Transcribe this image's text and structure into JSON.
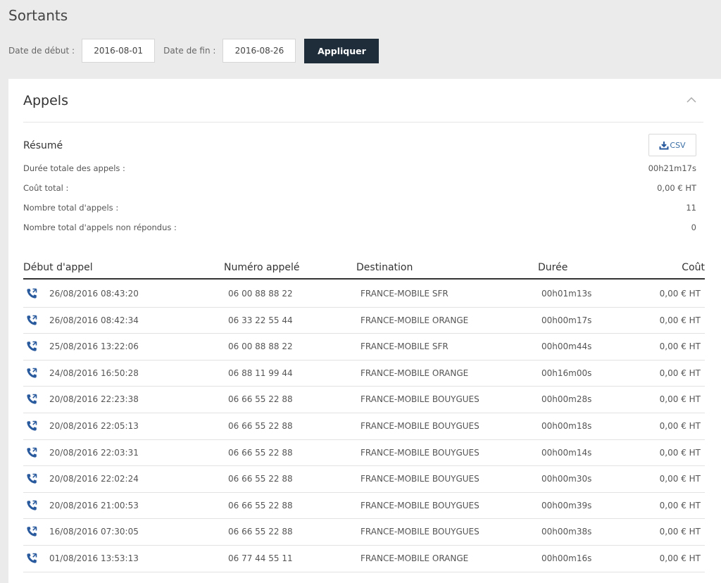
{
  "page": {
    "title": "Sortants"
  },
  "filters": {
    "start_label": "Date de début :",
    "start_value": "2016-08-01",
    "end_label": "Date de fin :",
    "end_value": "2016-08-26",
    "apply_label": "Appliquer"
  },
  "panel": {
    "title": "Appels",
    "collapse_icon": "chevron-up-icon",
    "summary": {
      "title": "Résumé",
      "csv_label": "CSV",
      "rows": [
        {
          "label": "Durée totale des appels :",
          "value": "00h21m17s"
        },
        {
          "label": "Coût total :",
          "value": "0,00 € HT"
        },
        {
          "label": "Nombre total d'appels :",
          "value": "11"
        },
        {
          "label": "Nombre total d'appels non répondus :",
          "value": "0"
        }
      ]
    },
    "table": {
      "headers": {
        "start": "Début d'appel",
        "number": "Numéro appelé",
        "destination": "Destination",
        "duration": "Durée",
        "cost": "Coût"
      },
      "row_icon": "outgoing-call-icon",
      "rows": [
        {
          "start": "26/08/2016 08:43:20",
          "number": "06 00 88 88 22",
          "destination": "FRANCE-MOBILE SFR",
          "duration": "00h01m13s",
          "cost": "0,00 € HT"
        },
        {
          "start": "26/08/2016 08:42:34",
          "number": "06 33 22 55 44",
          "destination": "FRANCE-MOBILE ORANGE",
          "duration": "00h00m17s",
          "cost": "0,00 € HT"
        },
        {
          "start": "25/08/2016 13:22:06",
          "number": "06 00 88 88 22",
          "destination": "FRANCE-MOBILE SFR",
          "duration": "00h00m44s",
          "cost": "0,00 € HT"
        },
        {
          "start": "24/08/2016 16:50:28",
          "number": "06 88 11 99 44",
          "destination": "FRANCE-MOBILE ORANGE",
          "duration": "00h16m00s",
          "cost": "0,00 € HT"
        },
        {
          "start": "20/08/2016 22:23:38",
          "number": "06 66 55 22 88",
          "destination": "FRANCE-MOBILE BOUYGUES",
          "duration": "00h00m28s",
          "cost": "0,00 € HT"
        },
        {
          "start": "20/08/2016 22:05:13",
          "number": "06 66 55 22 88",
          "destination": "FRANCE-MOBILE BOUYGUES",
          "duration": "00h00m18s",
          "cost": "0,00 € HT"
        },
        {
          "start": "20/08/2016 22:03:31",
          "number": "06 66 55 22 88",
          "destination": "FRANCE-MOBILE BOUYGUES",
          "duration": "00h00m14s",
          "cost": "0,00 € HT"
        },
        {
          "start": "20/08/2016 22:02:24",
          "number": "06 66 55 22 88",
          "destination": "FRANCE-MOBILE BOUYGUES",
          "duration": "00h00m30s",
          "cost": "0,00 € HT"
        },
        {
          "start": "20/08/2016 21:00:53",
          "number": "06 66 55 22 88",
          "destination": "FRANCE-MOBILE BOUYGUES",
          "duration": "00h00m39s",
          "cost": "0,00 € HT"
        },
        {
          "start": "16/08/2016 07:30:05",
          "number": "06 66 55 22 88",
          "destination": "FRANCE-MOBILE BOUYGUES",
          "duration": "00h00m38s",
          "cost": "0,00 € HT"
        },
        {
          "start": "01/08/2016 13:53:13",
          "number": "06 77 44 55 11",
          "destination": "FRANCE-MOBILE ORANGE",
          "duration": "00h00m16s",
          "cost": "0,00 € HT"
        }
      ]
    }
  },
  "colors": {
    "accent": "#2a5a9e",
    "button_dark": "#1f2d3a",
    "background": "#ebebeb"
  }
}
